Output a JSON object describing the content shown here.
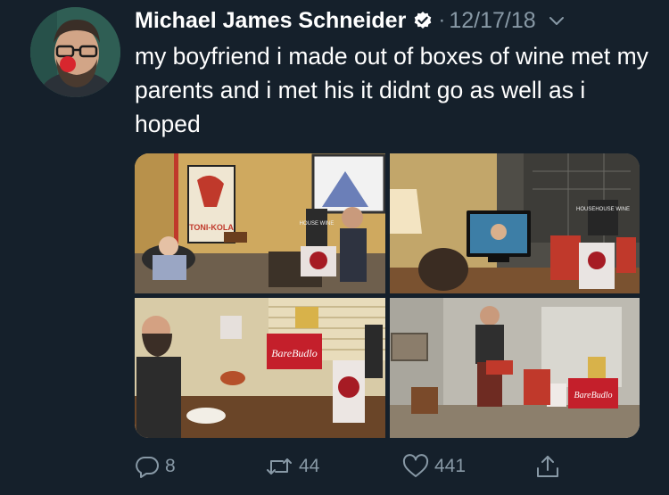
{
  "tweet": {
    "author_name": "Michael James Schneider",
    "separator": "·",
    "date": "12/17/18",
    "text": "my boyfriend i made out of boxes of wine met my parents and i met his it didnt go as well as i hoped"
  },
  "actions": {
    "replies": "8",
    "retweets": "44",
    "likes": "441"
  },
  "photos": {
    "photo1_poster_text": "TONI-KOLA",
    "photo1_box_text": "HOUSE WINE",
    "photo2_box_text": "HOUSEHOUSE WINE",
    "photo3_box_text": "BareBudlo",
    "photo4_box_text": "BareBudlo"
  },
  "colors": {
    "background": "#15202b",
    "secondary_text": "#8899a6",
    "verified_badge": "#ffffff",
    "primary_text": "#ffffff"
  }
}
